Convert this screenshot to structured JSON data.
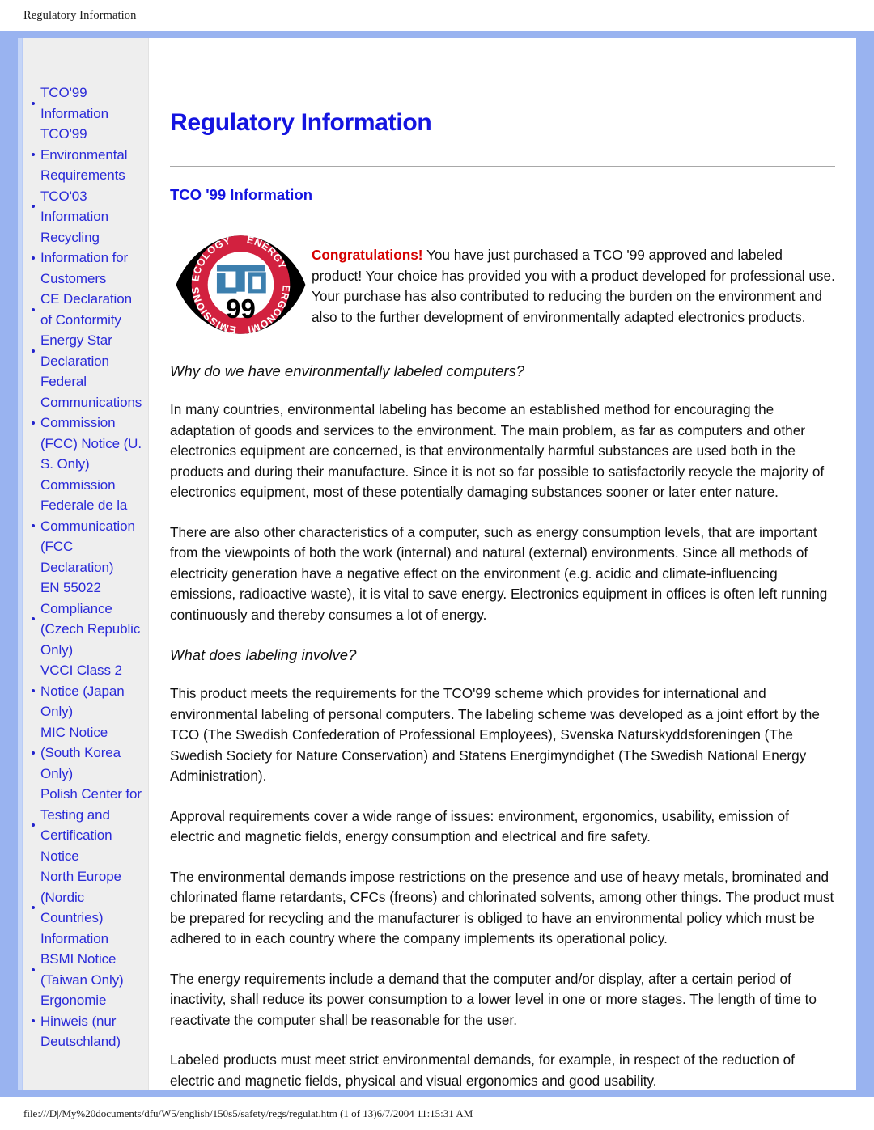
{
  "browser": {
    "header_title": "Regulatory Information",
    "footer_text": "file:///D|/My%20documents/dfu/W5/english/150s5/safety/regs/regulat.htm (1 of 13)6/7/2004 11:15:31 AM"
  },
  "colors": {
    "frame_blue": "#99b3f0",
    "sidebar_bg": "#eeeeee",
    "link_blue": "#2a2ad8",
    "heading_blue": "#1414e0",
    "congrats_red": "#d60000",
    "logo_ring_red": "#d2213f",
    "logo_tco_blue": "#3c7fae"
  },
  "sidebar": {
    "items": [
      {
        "label": "TCO'99 Information"
      },
      {
        "label": "TCO'99 Environmental Requirements"
      },
      {
        "label": "TCO'03 Information"
      },
      {
        "label": "Recycling Information for Customers"
      },
      {
        "label": "CE Declaration of Conformity"
      },
      {
        "label": "Energy Star Declaration"
      },
      {
        "label": "Federal Communications Commission (FCC) Notice (U. S. Only)"
      },
      {
        "label": "Commission Federale de la Communication (FCC Declaration)"
      },
      {
        "label": "EN 55022 Compliance (Czech Republic Only)"
      },
      {
        "label": "VCCI Class 2 Notice (Japan Only)"
      },
      {
        "label": "MIC Notice (South Korea Only)"
      },
      {
        "label": "Polish Center for Testing and Certification Notice"
      },
      {
        "label": "North Europe (Nordic Countries) Information"
      },
      {
        "label": "BSMI Notice (Taiwan Only)"
      },
      {
        "label": "Ergonomie Hinweis (nur Deutschland)"
      }
    ]
  },
  "main": {
    "page_title": "Regulatory Information",
    "section_title": "TCO '99 Information",
    "logo": {
      "name": "tco-99-certification-logo",
      "ring_top_left": "ECOLOGY",
      "ring_top_right": "ENERGY",
      "ring_bottom_left": "EMISSIONS",
      "ring_bottom_right": "ERGONOMICS",
      "center_mark": "TCO",
      "center_year": "99"
    },
    "congrats_lead": "Congratulations!",
    "congrats_body": " You have just purchased a TCO '99 approved and labeled product! Your choice has provided you with a product developed for professional use. Your purchase has also contributed to reducing the burden on the environment and also to the further development of environmentally adapted electronics products.",
    "subhead_why": "Why do we have environmentally labeled computers?",
    "para_why_1": "In many countries, environmental labeling has become an established method for encouraging the adaptation of goods and services to the environment. The main problem, as far as computers and other electronics equipment are concerned, is that environmentally harmful substances are used both in the products and during their manufacture. Since it is not so far possible to satisfactorily recycle the majority of electronics equipment, most of these potentially damaging substances sooner or later enter nature.",
    "para_why_2": "There are also other characteristics of a computer, such as energy consumption levels, that are important from the viewpoints of both the work (internal) and natural (external) environments. Since all methods of electricity generation have a negative effect on the environment (e.g. acidic and climate-influencing emissions, radioactive waste), it is vital to save energy. Electronics equipment in offices is often left running continuously and thereby consumes a lot of energy.",
    "subhead_labeling": "What does labeling involve?",
    "para_label_1": "This product meets the requirements for the TCO'99 scheme which provides for international and environmental labeling of personal computers. The labeling scheme was developed as a joint effort by the TCO (The Swedish Confederation of Professional Employees), Svenska Naturskyddsforeningen (The Swedish Society for Nature Conservation) and Statens Energimyndighet (The Swedish National Energy Administration).",
    "para_label_2": "Approval requirements cover a wide range of issues: environment, ergonomics, usability, emission of electric and magnetic fields, energy consumption and electrical and fire safety.",
    "para_label_3": "The environmental demands impose restrictions on the presence and use of heavy metals, brominated and chlorinated flame retardants, CFCs (freons) and chlorinated solvents, among other things. The product must be prepared for recycling and the manufacturer is obliged to have an environmental policy which must be adhered to in each country where the company implements its operational policy.",
    "para_label_4": "The energy requirements include a demand that the computer and/or display, after a certain period of inactivity, shall reduce its power consumption to a lower level in one or more stages. The length of time to reactivate the computer shall be reasonable for the user.",
    "para_label_5": "Labeled products must meet strict environmental demands, for example, in respect of the reduction of electric and magnetic fields, physical and visual ergonomics and good usability."
  }
}
